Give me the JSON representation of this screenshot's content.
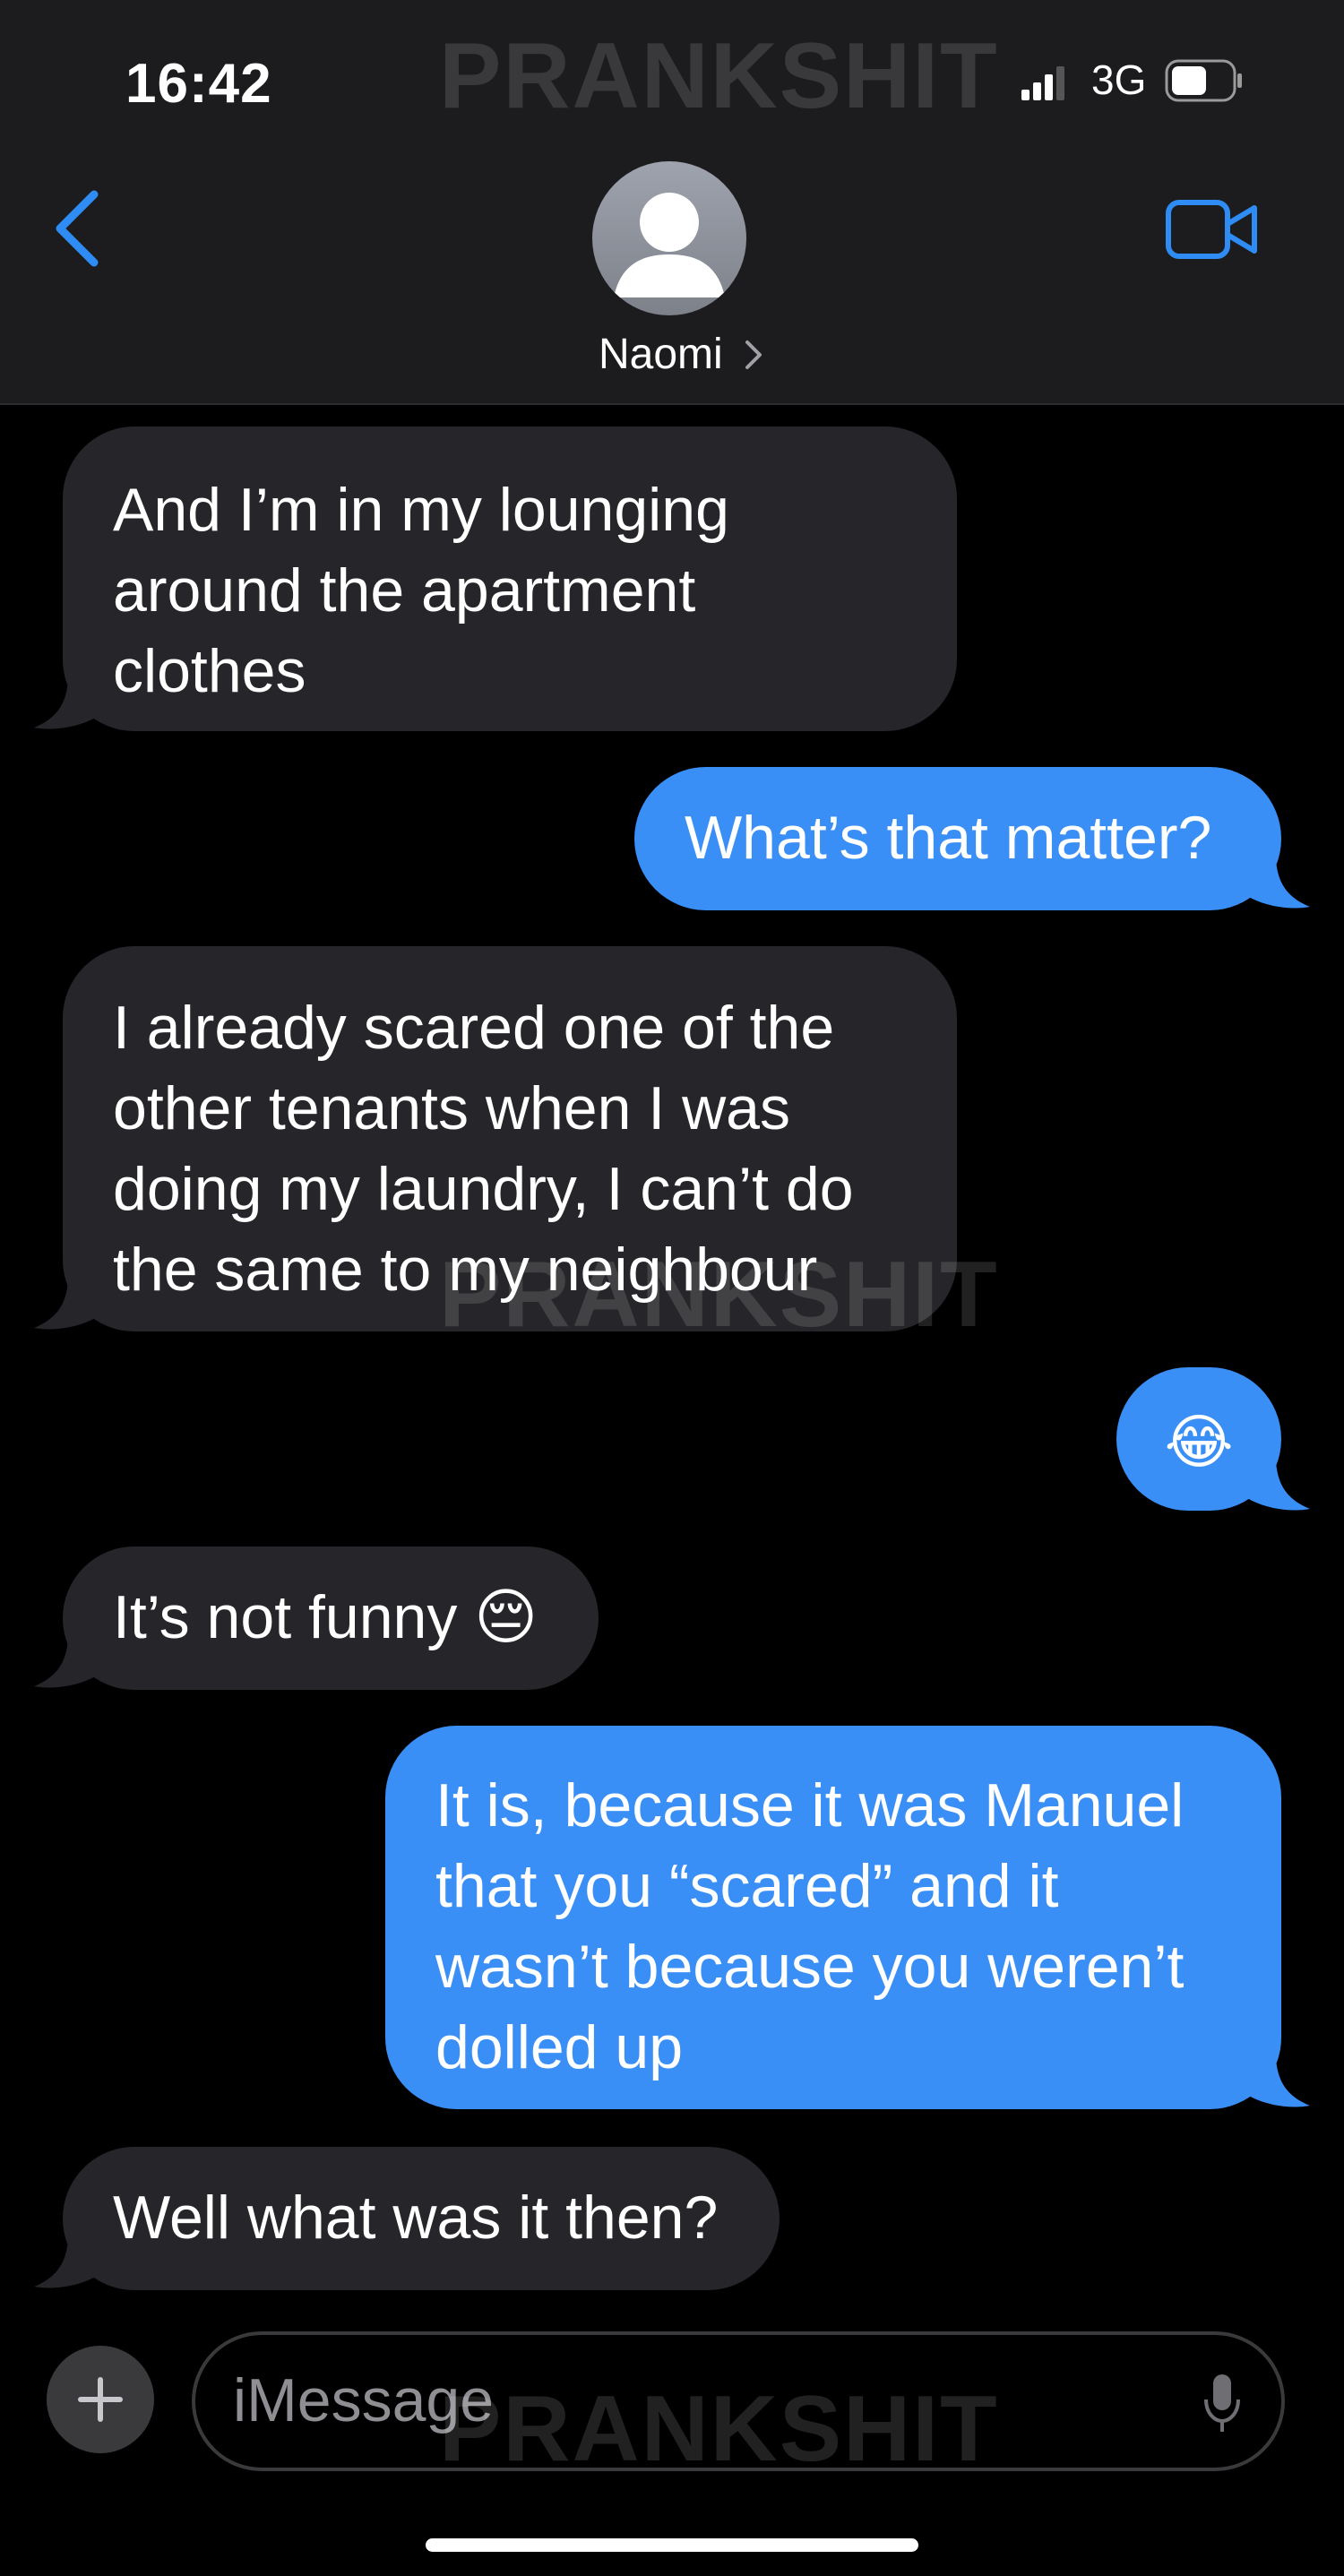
{
  "status_bar": {
    "time": "16:42",
    "network": "3G",
    "watermark": "PRANKSHIT"
  },
  "header": {
    "contact_name": "Naomi",
    "back_icon": "chevron-left-icon",
    "video_icon": "video-camera-icon",
    "accent_color": "#2f8cf5"
  },
  "messages": [
    {
      "direction": "incoming",
      "text": "And I’m in my lounging\naround the apartment\nclothes"
    },
    {
      "direction": "outgoing",
      "text": "What’s that matter?"
    },
    {
      "direction": "incoming",
      "text": "I already scared one of the\nother tenants when I was\ndoing my laundry, I can’t do\nthe same to my neighbour"
    },
    {
      "direction": "outgoing",
      "text": "😂"
    },
    {
      "direction": "incoming",
      "text": "It’s not funny 😔"
    },
    {
      "direction": "outgoing",
      "text": "It is, because it was Manuel\nthat you “scared” and it\nwasn’t because you weren’t\ndolled up"
    },
    {
      "direction": "incoming",
      "text": "Well what was it then?"
    }
  ],
  "watermarks": [
    "PRANKSHIT",
    "PRANKSHIT",
    "PRANKSHIT"
  ],
  "composer": {
    "placeholder": "iMessage",
    "plus_icon": "plus-icon",
    "mic_icon": "microphone-icon"
  },
  "colors": {
    "incoming_bubble": "#26262a",
    "outgoing_bubble": "#3a8ff7",
    "header_bg": "#1c1c1e"
  }
}
